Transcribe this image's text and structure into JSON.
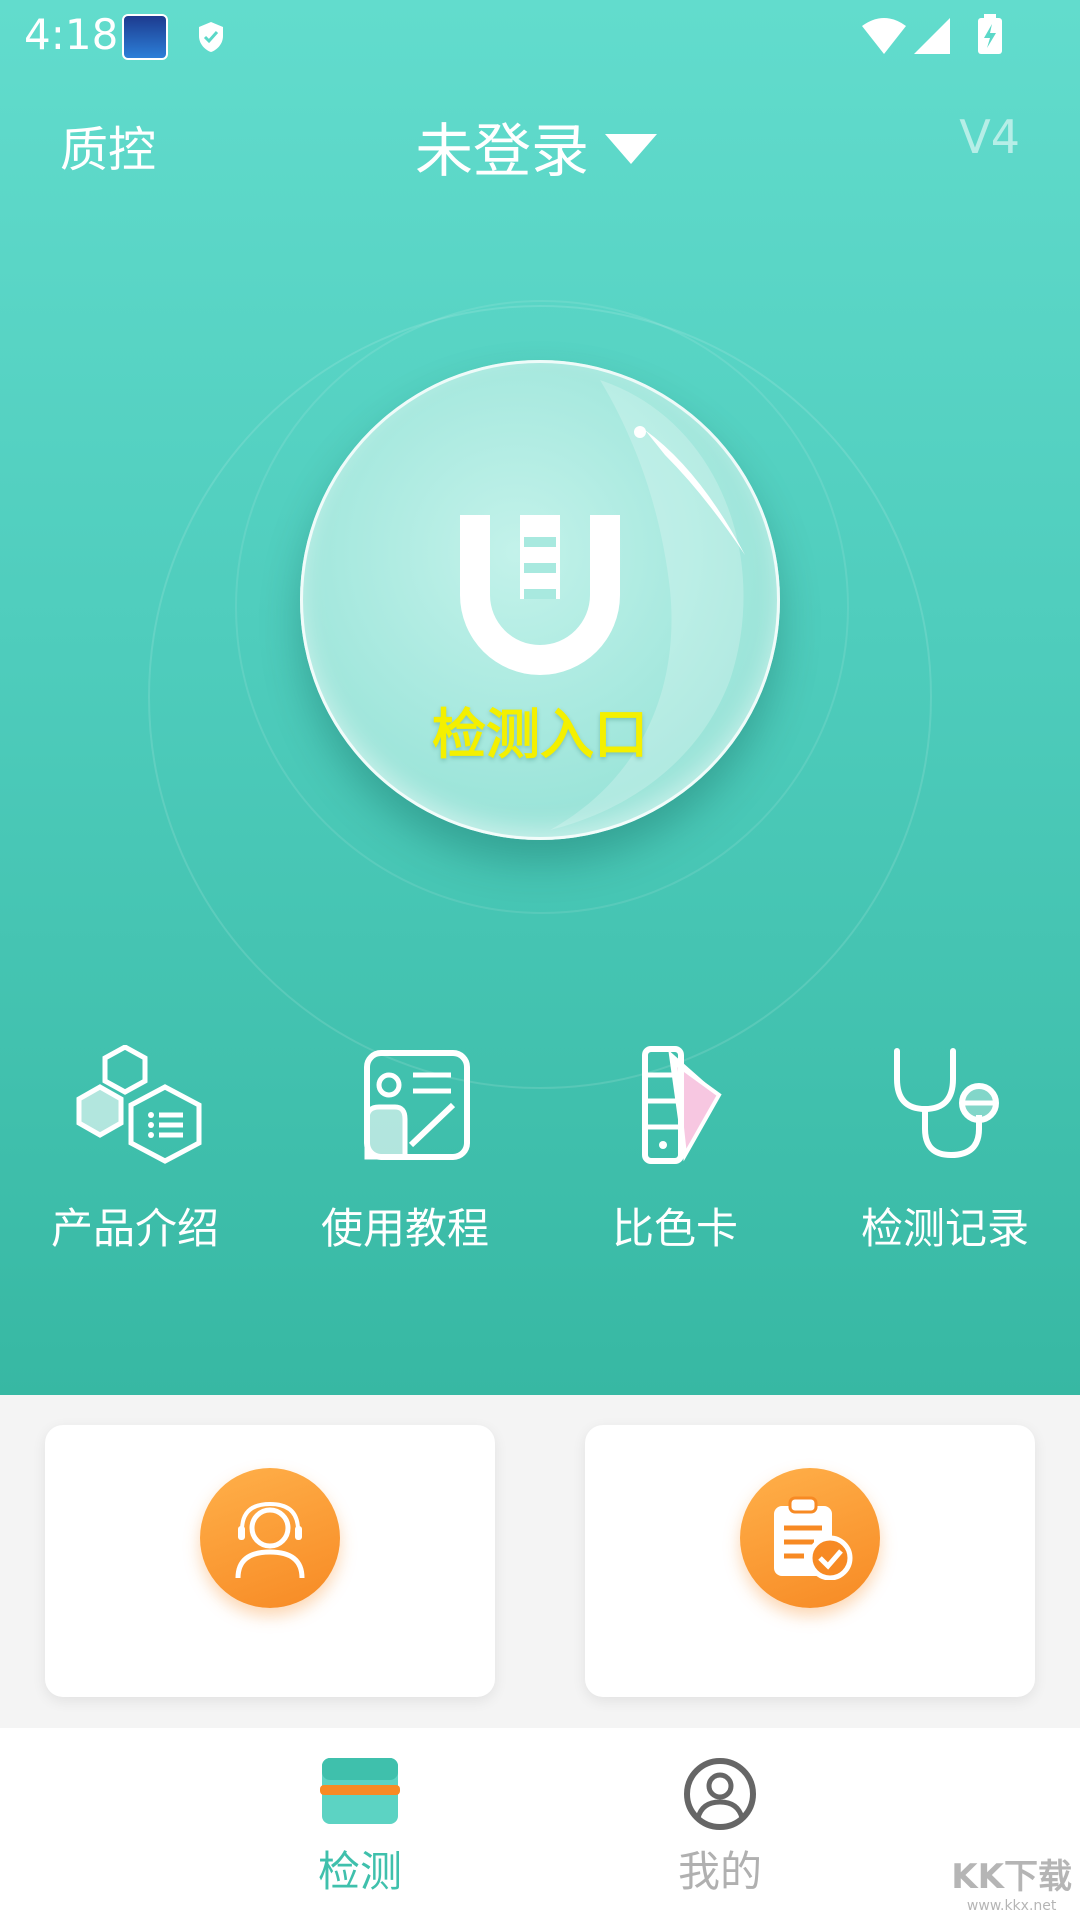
{
  "status_bar": {
    "time": "4:18"
  },
  "header": {
    "qc_label": "质控",
    "login_label": "未登录",
    "version": "V4"
  },
  "entry": {
    "label": "检测入口"
  },
  "features": [
    {
      "label": "产品介绍",
      "icon": "hexagon-list-icon"
    },
    {
      "label": "使用教程",
      "icon": "tutorial-card-icon"
    },
    {
      "label": "比色卡",
      "icon": "color-swatch-icon"
    },
    {
      "label": "检测记录",
      "icon": "stethoscope-icon"
    }
  ],
  "cards": [
    {
      "icon": "customer-service-icon"
    },
    {
      "icon": "clipboard-check-icon"
    }
  ],
  "bottom_nav": {
    "items": [
      {
        "label": "检测",
        "active": true,
        "icon": "scan-icon"
      },
      {
        "label": "我的",
        "active": false,
        "icon": "user-circle-icon"
      }
    ]
  },
  "watermark": {
    "text": "KK下载",
    "url": "www.kkx.net"
  },
  "colors": {
    "primary": "#4fcdbd",
    "entry_text": "#f4f000",
    "accent_orange": "#f78a24",
    "nav_active": "#3fc0ac",
    "nav_inactive": "#b0b0b0"
  }
}
